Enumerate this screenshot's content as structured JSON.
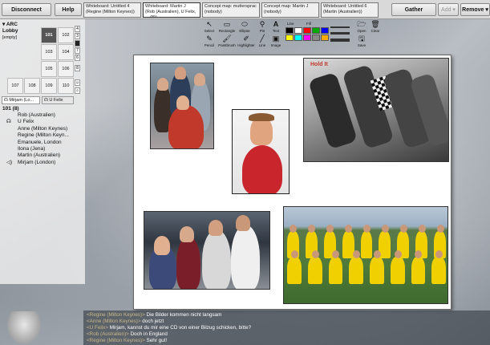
{
  "topbar": {
    "disconnect": "Disconnect",
    "help": "Help",
    "tabs": [
      {
        "line1": "Whiteboard: Untitled 4",
        "line2": "(Regine (Milton Keynes))"
      },
      {
        "line1": "Whiteboard: Martin J",
        "line2": "(Rob (Australien), U Felix, ... (8))"
      },
      {
        "line1": "Concept map: muttersprac",
        "line2": "(nobody)"
      },
      {
        "line1": "Concept map: Martin J",
        "line2": "(nobody)"
      },
      {
        "line1": "Whiteboard: Untitled 6",
        "line2": "(Martin (Australien))"
      }
    ],
    "gather": "Gather",
    "add": "Add ▾",
    "remove": "Remove ▾"
  },
  "left": {
    "app": "ARC",
    "lobby": "Lobby",
    "empty": "[empty]",
    "rooms": [
      "101",
      "102",
      "103",
      "104",
      "105",
      "106",
      "107",
      "108",
      "109",
      "110"
    ],
    "tiny": [
      "4",
      "3",
      "7",
      "6",
      "8",
      "9"
    ],
    "tabs": [
      "Mirjam (Lo...",
      "U Felix"
    ],
    "room_title": "101 (8)",
    "users": [
      "Rob (Australien)",
      "U Felix",
      "Anne (Milton Keynes)",
      "Regine (Milton Keyn...",
      "Emanuele, London",
      "Ilona (Jena)",
      "Martin (Australien)",
      "Mirjam (London)"
    ]
  },
  "tools": {
    "select": "Select",
    "rectangle": "Rectangle",
    "ellipse": "Ellipse",
    "pin": "Pin",
    "text": "Text",
    "pencil": "Pencil",
    "paintbrush": "Paintbrush",
    "highlighter": "Highlighter",
    "line": "Line",
    "image": "Image",
    "line_label": "Line",
    "fill_label": "Fill",
    "open": "Open",
    "clear": "Clear",
    "save": "Save"
  },
  "palette": [
    "#000000",
    "#ffffff",
    "#ff0000",
    "#00aa00",
    "#0000ff",
    "#ffff00",
    "#00ffff",
    "#ff00ff",
    "#888888",
    "#ffaa00"
  ],
  "canvas": {
    "photo_caption": "Hold It"
  },
  "chat": [
    {
      "who": "<Regine (Milton Keynes)>",
      "msg": " Die Bilder kommen nicht langsam"
    },
    {
      "who": "<Anne (Milton Keynes)>",
      "msg": " doch jetzt"
    },
    {
      "who": "<U Felix>",
      "msg": " Mirjam, kannst du mir eine CD von einer Bilzug schicken, bitte?"
    },
    {
      "who": "<Rob (Australien)>",
      "msg": " Doch in England"
    },
    {
      "who": "<Regine (Milton Keynes)>",
      "msg": " Sehr gut!"
    }
  ]
}
